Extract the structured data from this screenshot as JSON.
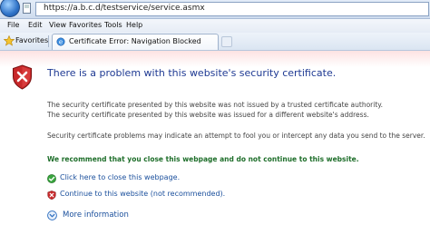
{
  "address_bar": {
    "url": "https://a.b.c.d/testservice/service.asmx"
  },
  "menu": {
    "items": [
      "File",
      "Edit",
      "View",
      "Favorites",
      "Tools",
      "Help"
    ]
  },
  "favorites_bar": {
    "label": "Favorites"
  },
  "tab": {
    "title": "Certificate Error: Navigation Blocked"
  },
  "page": {
    "heading": "There is a problem with this website's security certificate.",
    "paragraph1_line1": "The security certificate presented by this website was not issued by a trusted certificate authority.",
    "paragraph1_line2": "The security certificate presented by this website was issued for a different website's address.",
    "paragraph2": "Security certificate problems may indicate an attempt to fool you or intercept any data you send to the server.",
    "recommendation": "We recommend that you close this webpage and do not continue to this website.",
    "close_link": "Click here to close this webpage.",
    "continue_link": "Continue to this website (not recommended).",
    "more_info": "More information"
  },
  "colors": {
    "heading": "#1f3a93",
    "recommendation": "#1e6e2a",
    "link": "#1a4f9c",
    "shield_red": "#c8282a"
  }
}
